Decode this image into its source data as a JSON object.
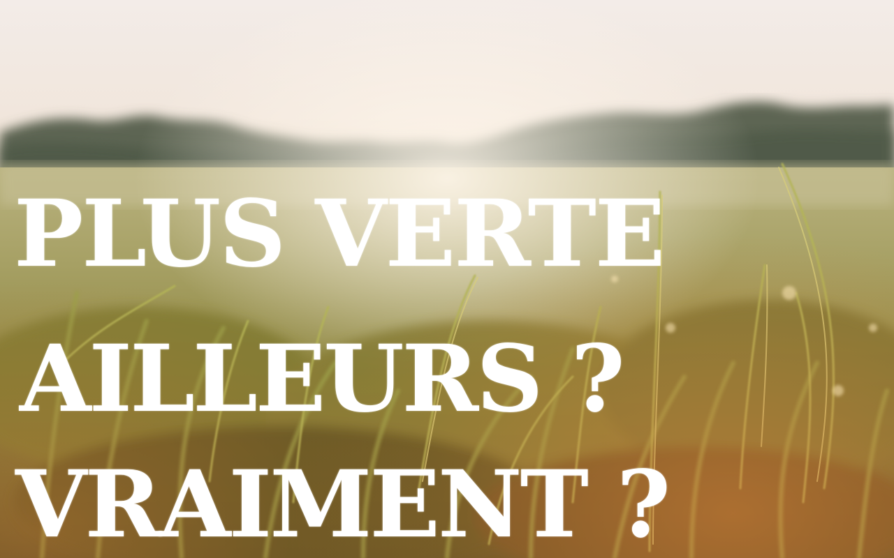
{
  "headline": {
    "line1": "PLUS VERTE",
    "line2": "AILLEURS ?",
    "line3": "VRAIMENT ?"
  },
  "colors": {
    "text": "#ffffff",
    "sky": "#f4ece6",
    "treeline": "#5f6650",
    "grass_light": "#c9b56a",
    "grass_dark": "#5a5a22",
    "warm_glow": "#d98a45"
  },
  "background": {
    "description_icon": "grass-field-photo"
  }
}
